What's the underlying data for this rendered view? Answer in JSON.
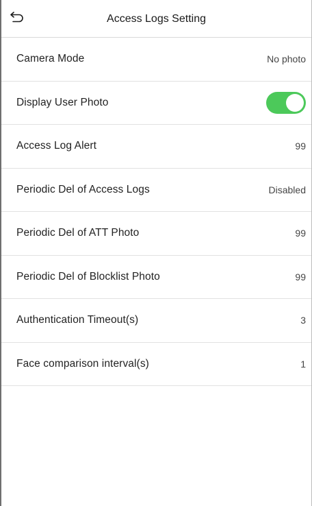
{
  "header": {
    "title": "Access Logs Setting",
    "back_icon": "back-arrow-icon"
  },
  "colors": {
    "toggle_on": "#4cc95a",
    "divider": "#e1e1e1"
  },
  "settings": [
    {
      "label": "Camera Mode",
      "value": "No photo",
      "type": "value"
    },
    {
      "label": "Display User Photo",
      "value": "",
      "type": "toggle",
      "on": true
    },
    {
      "label": "Access Log Alert",
      "value": "99",
      "type": "value"
    },
    {
      "label": "Periodic Del of Access Logs",
      "value": "Disabled",
      "type": "value"
    },
    {
      "label": "Periodic Del of ATT Photo",
      "value": "99",
      "type": "value"
    },
    {
      "label": "Periodic Del of Blocklist Photo",
      "value": "99",
      "type": "value"
    },
    {
      "label": "Authentication Timeout(s)",
      "value": "3",
      "type": "value"
    },
    {
      "label": "Face comparison interval(s)",
      "value": "1",
      "type": "value"
    }
  ]
}
